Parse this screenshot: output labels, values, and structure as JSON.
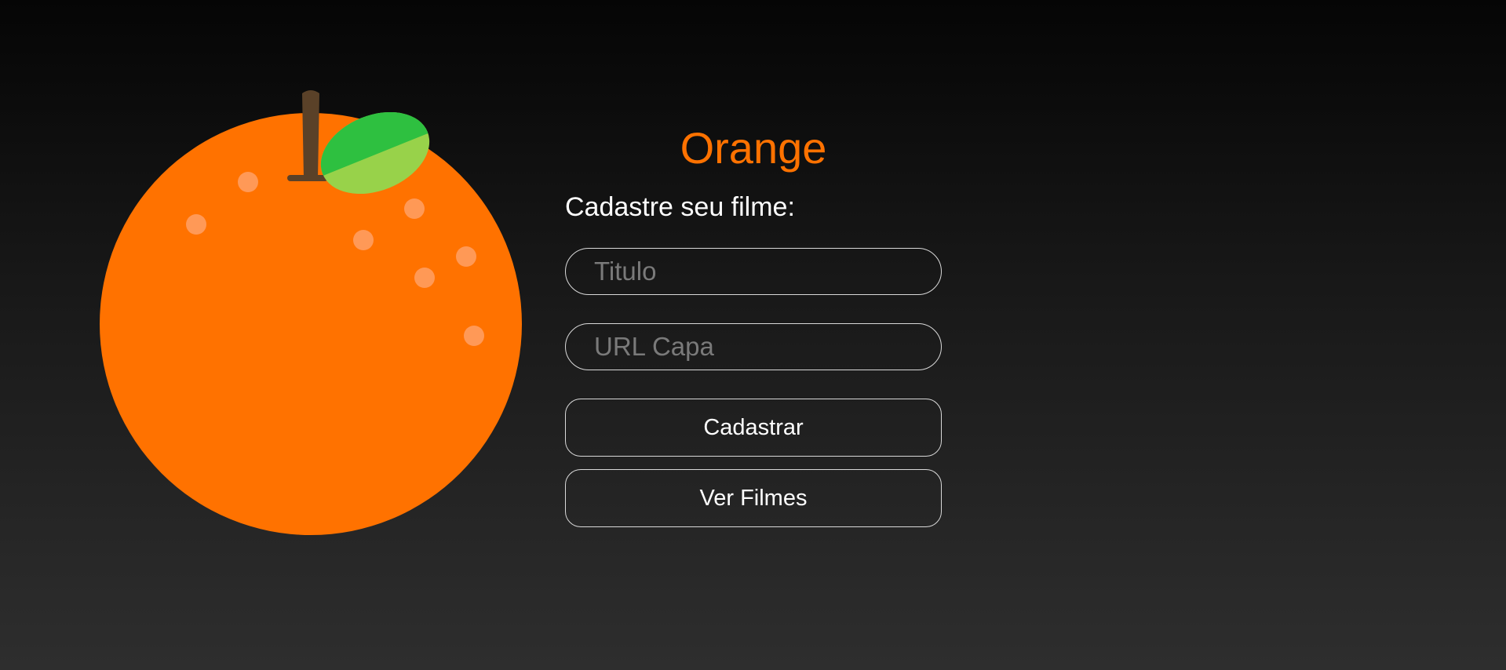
{
  "brand": {
    "title": "Orange",
    "color": "#ff7200"
  },
  "form": {
    "heading": "Cadastre seu filme:",
    "title_field": {
      "placeholder": "Titulo",
      "value": ""
    },
    "cover_url_field": {
      "placeholder": "URL Capa",
      "value": ""
    },
    "submit_label": "Cadastrar",
    "view_movies_label": "Ver Filmes"
  },
  "illustration": {
    "icon": "orange-fruit-icon",
    "colors": {
      "fruit": "#ff7200",
      "leaf_dark": "#2ec040",
      "leaf_light": "#98d24a",
      "stem": "#5a4128",
      "dots": "#ffa066"
    }
  }
}
